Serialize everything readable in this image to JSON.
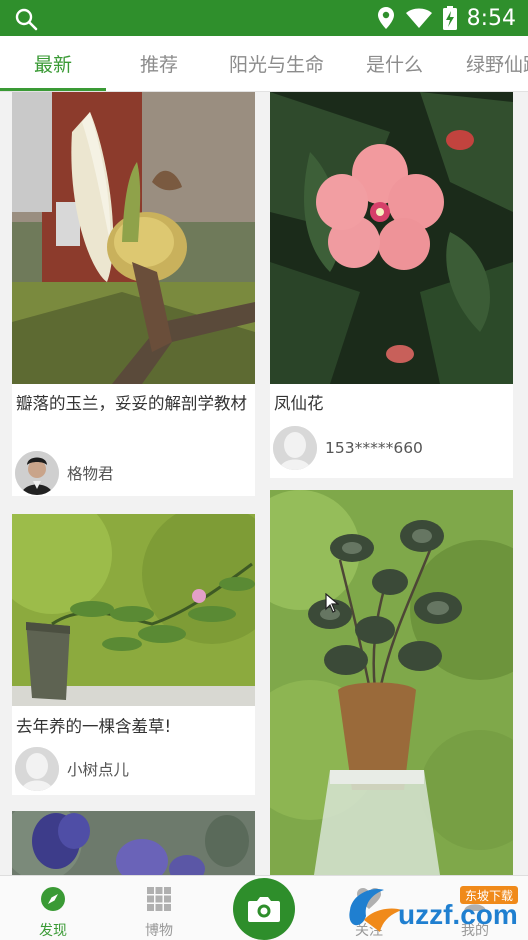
{
  "status_bar": {
    "time": "8:54",
    "icons": [
      "search-icon",
      "location-icon",
      "wifi-icon",
      "battery-icon"
    ]
  },
  "tabs": [
    {
      "label": "最新",
      "active": true
    },
    {
      "label": "推荐",
      "active": false
    },
    {
      "label": "阳光与生命",
      "active": false
    },
    {
      "label": "是什么",
      "active": false
    },
    {
      "label": "绿野仙踪",
      "active": false
    }
  ],
  "feed": {
    "cards": [
      {
        "title": "瓣落的玉兰，妥妥的解剖学教材",
        "author": "格物君"
      },
      {
        "title": "凤仙花",
        "author": "153*****660"
      },
      {
        "title": "去年养的一棵含羞草!",
        "author": "小树点儿"
      },
      {
        "title": "",
        "author": ""
      },
      {
        "title": "",
        "author": ""
      }
    ]
  },
  "bottom_nav": {
    "items": [
      {
        "label": "发现",
        "icon": "compass-icon",
        "active": true
      },
      {
        "label": "博物",
        "icon": "grid-icon",
        "active": false
      },
      {
        "label": "",
        "icon": "camera-icon",
        "active": false
      },
      {
        "label": "关注",
        "icon": "heart-icon",
        "active": false
      },
      {
        "label": "我的",
        "icon": "user-icon",
        "active": false
      }
    ]
  },
  "watermark": {
    "text": "uzzf.com",
    "tag": "东坡下载"
  },
  "colors": {
    "primary": "#3a9a35",
    "status_bar": "#2f8f2c",
    "background": "#f2f2f2"
  }
}
